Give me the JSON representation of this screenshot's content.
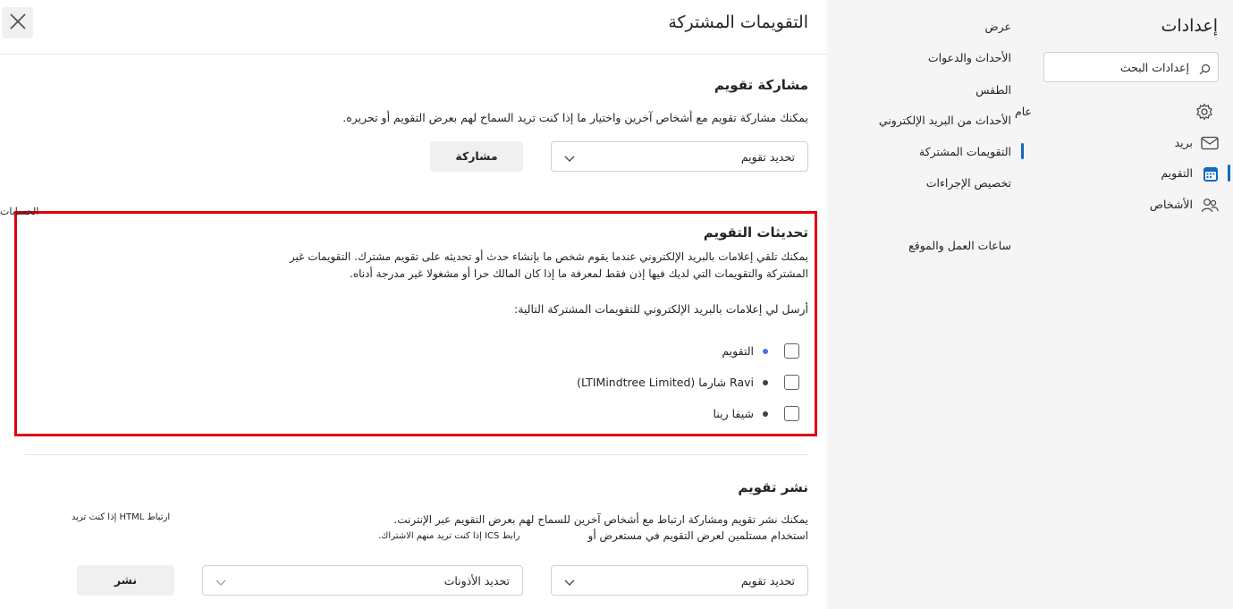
{
  "settings": {
    "title": "إعدادات",
    "search_placeholder": "إعدادات البحث",
    "main_nav": [
      {
        "label": "عام",
        "icon": "gear-icon"
      },
      {
        "label": "بريد",
        "icon": "mail-icon"
      },
      {
        "label": "التقويم",
        "icon": "calendar-icon",
        "selected": true
      },
      {
        "label": "الأشخاص",
        "icon": "people-icon"
      }
    ],
    "sub_nav": [
      {
        "label": "عرض"
      },
      {
        "label": "الأحداث والدعوات"
      },
      {
        "label": "الطقس"
      },
      {
        "label": "الأحداث من البريد الإلكتروني"
      },
      {
        "label": "التقويمات المشتركة",
        "selected": true
      },
      {
        "label": "تخصيص الإجراءات"
      },
      {
        "label": "الحسابات"
      },
      {
        "label": "ساعات العمل والموقع"
      }
    ]
  },
  "panel": {
    "title": "التقويمات المشتركة",
    "share": {
      "heading": "مشاركة تقويم",
      "description": "يمكنك مشاركة تقويم مع أشخاص آخرين واختيار ما إذا كنت تريد السماح لهم بعرض التقويم أو تحريره.",
      "calendar_dropdown": "تحديد تقويم",
      "share_button": "مشاركة"
    },
    "updates": {
      "heading": "تحديثات التقويم",
      "description_line1": "يمكنك تلقي إعلامات بالبريد الإلكتروني عندما يقوم شخص ما بإنشاء حدث أو تحديثه على تقويم مشترك. التقويمات غير",
      "description_line2": "المشتركة والتقويمات التي لديك فيها إذن فقط لمعرفة ما إذا كان المالك حرا أو مشغولا غير مدرجة أدناه.",
      "prompt": "أرسل لي إعلامات بالبريد الإلكتروني للتقويمات المشتركة التالية:",
      "calendars": [
        {
          "label": "التقويم",
          "color": "#4f6bed",
          "checked": false
        },
        {
          "label": "Ravi شارما (LTIMindtree Limited)",
          "color": "#424242",
          "checked": false
        },
        {
          "label": "شيفا رينا",
          "color": "#424242",
          "checked": false
        }
      ]
    },
    "publish": {
      "heading": "نشر تقويم",
      "description_line1": "يمكنك نشر تقويم ومشاركة ارتباط مع أشخاص آخرين للسماح لهم بعرض التقويم عبر الإنترنت.",
      "description_line2": "استخدام مستلمين لعرض التقويم في مستعرض أو",
      "html_note": "ارتباط HTML إذا كنت تريد",
      "ics_note": "رابط ICS إذا كنت تريد منهم الاشتراك.",
      "calendar_dropdown": "تحديد تقويم",
      "permissions_dropdown": "تحديد الأذونات",
      "publish_button": "نشر"
    }
  },
  "colors": {
    "accent": "#0f6cbd",
    "highlight_border": "#e0000a"
  }
}
